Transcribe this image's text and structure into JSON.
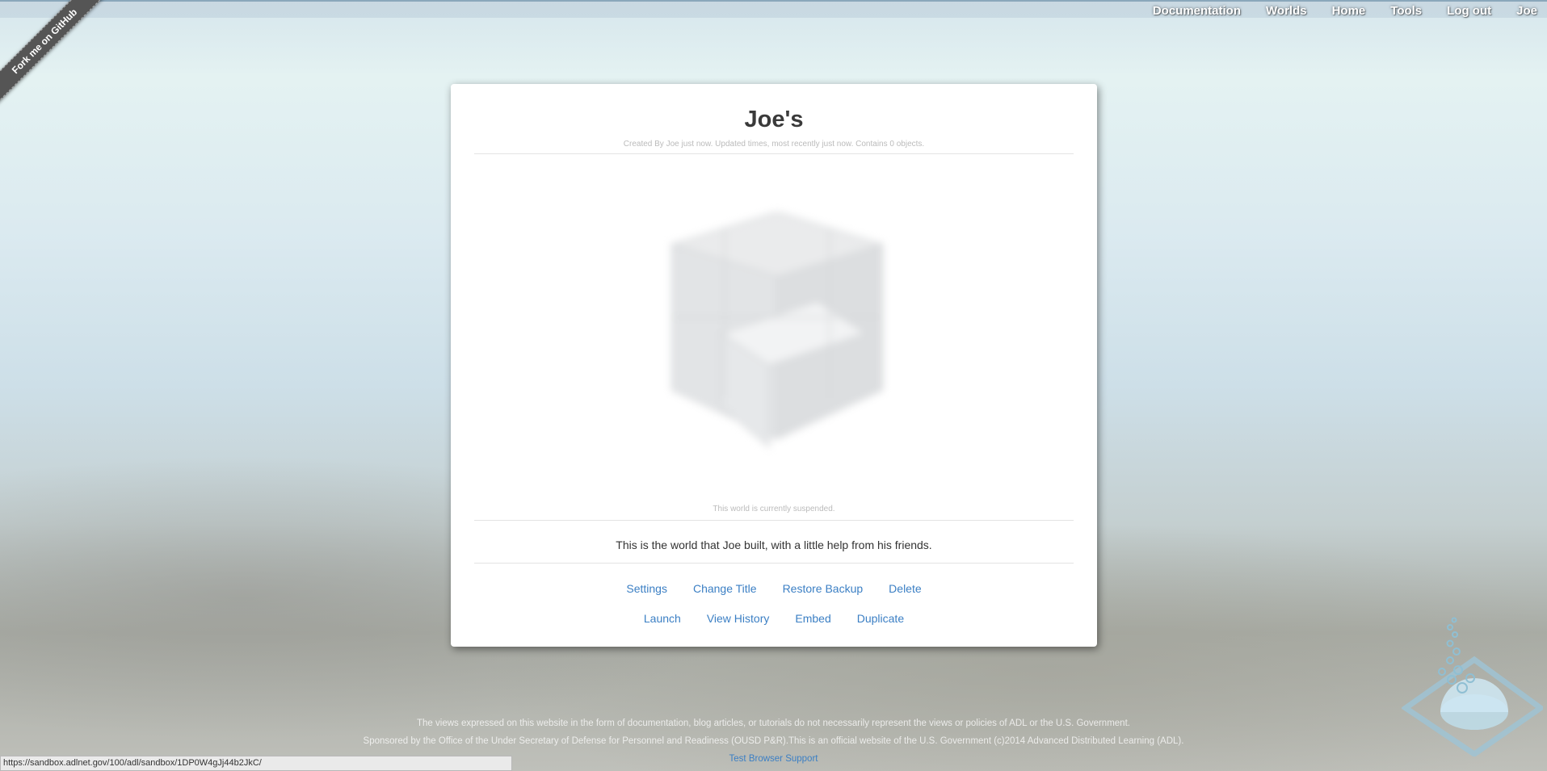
{
  "nav": {
    "items": [
      "Documentation",
      "Worlds",
      "Home",
      "Tools",
      "Log out",
      "Joe"
    ]
  },
  "ribbon": {
    "label": "Fork me on GitHub"
  },
  "world": {
    "title": "Joe's",
    "meta": "Created By Joe just now. Updated times, most recently just now. Contains 0 objects.",
    "suspended": "This world is currently suspended.",
    "description": "This is the world that Joe built, with a little help from his friends."
  },
  "actions": {
    "row1": [
      "Settings",
      "Change Title",
      "Restore Backup",
      "Delete"
    ],
    "row2": [
      "Launch",
      "View History",
      "Embed",
      "Duplicate"
    ]
  },
  "footer": {
    "line1": "The views expressed on this website in the form of documentation, blog articles, or tutorials do not necessarily represent the views or policies of ADL or the U.S. Government.",
    "line2": "Sponsored by the Office of the Under Secretary of Defense for Personnel and Readiness (OUSD P&R).This is an official website of the U.S. Government (c)2014 Advanced Distributed Learning (ADL).",
    "link": "Test Browser Support"
  },
  "status_url": "https://sandbox.adlnet.gov/100/adl/sandbox/1DP0W4gJj44b2JkC/",
  "colors": {
    "link": "#3b7fc4",
    "title": "#3a3a3a"
  }
}
